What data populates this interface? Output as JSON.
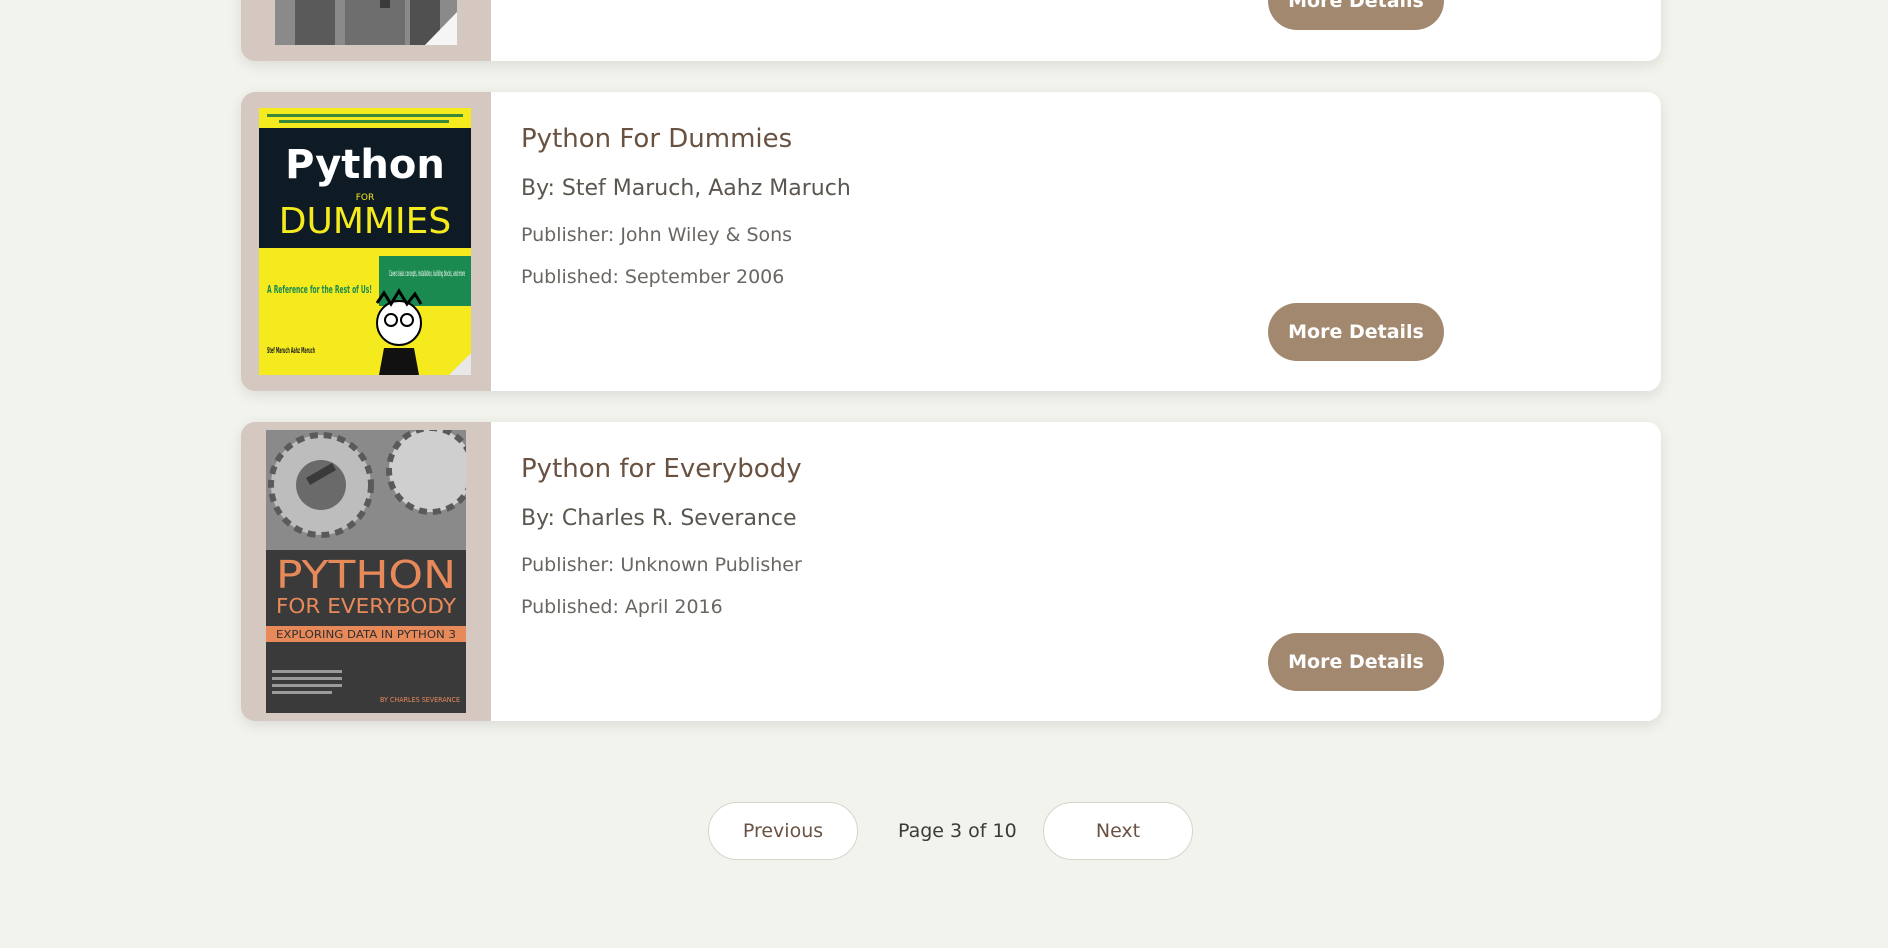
{
  "colors": {
    "page_background": "#f3f3ee",
    "card_background": "#ffffff",
    "cover_frame": "#d4c8c0",
    "title": "#6a5242",
    "button": "#a38870",
    "button_text": "#ffffff"
  },
  "books": [
    {
      "title": "",
      "author": "",
      "publisher": "",
      "published": "",
      "details_label": "More Details",
      "cover_icon": "castle-cover-image"
    },
    {
      "title": "Python For Dummies",
      "author": "By: Stef Maruch, Aahz Maruch",
      "publisher": "Publisher: John Wiley & Sons",
      "published": "Published: September 2006",
      "details_label": "More Details",
      "cover_icon": "python-for-dummies-cover-image",
      "cover_text": {
        "main": "Python",
        "for": "FOR",
        "series": "DUMMIES",
        "tagline": "A Reference for the Rest of Us!",
        "badge": "Covers basic concepts, installation, building blocks, and more",
        "authors": "Stef Maruch Aahz Maruch"
      }
    },
    {
      "title": "Python for Everybody",
      "author": "By: Charles R. Severance",
      "publisher": "Publisher: Unknown Publisher",
      "published": "Published: April 2016",
      "details_label": "More Details",
      "cover_icon": "python-for-everybody-cover-image",
      "cover_text": {
        "line1": "PYTHON",
        "line2": "FOR EVERYBODY",
        "band": "EXPLORING DATA IN PYTHON 3",
        "author": "BY CHARLES SEVERANCE"
      }
    }
  ],
  "pagination": {
    "previous_label": "Previous",
    "page_info": "Page 3 of 10",
    "next_label": "Next"
  }
}
